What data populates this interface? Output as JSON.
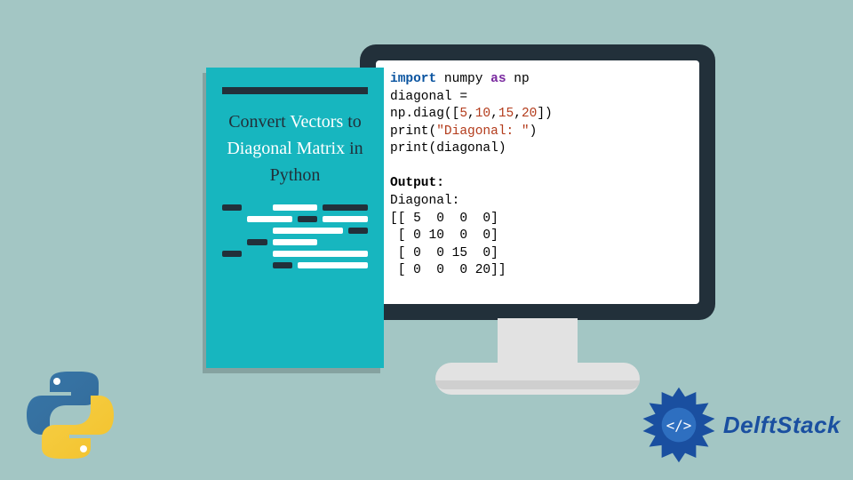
{
  "colors": {
    "background": "#a3c6c4",
    "teal": "#17b6bf",
    "dark": "#22303a",
    "white": "#ffffff",
    "keywordBlue": "#0a54a0",
    "keywordPurple": "#7a2aa0",
    "literalRed": "#b33b1b",
    "brandBlue": "#1a4fa0"
  },
  "card": {
    "title_parts": {
      "p1": "Convert ",
      "hl1": "Vectors",
      "p2": " to ",
      "hl2": "Diagonal Matrix",
      "p3": " in Python"
    }
  },
  "code": {
    "line1": {
      "kw_import": "import",
      "mod": " numpy ",
      "kw_as": "as",
      "alias": " np"
    },
    "line2": "diagonal =",
    "line3": {
      "pre": "np.diag([",
      "n1": "5",
      "c1": ",",
      "n2": "10",
      "c2": ",",
      "n3": "15",
      "c3": ",",
      "n4": "20",
      "post": "])"
    },
    "line4": {
      "fn": "print(",
      "str": "\"Diagonal: \"",
      "close": ")"
    },
    "line5": "print(diagonal)",
    "blank": "",
    "output_label": "Output:",
    "out1": "Diagonal:",
    "out2": "[[ 5  0  0  0]",
    "out3": " [ 0 10  0  0]",
    "out4": " [ 0  0 15  0]",
    "out5": " [ 0  0  0 20]]"
  },
  "brand": {
    "name": "DelftStack"
  },
  "logos": {
    "python": "python-logo",
    "delft": "delftstack-logo"
  }
}
